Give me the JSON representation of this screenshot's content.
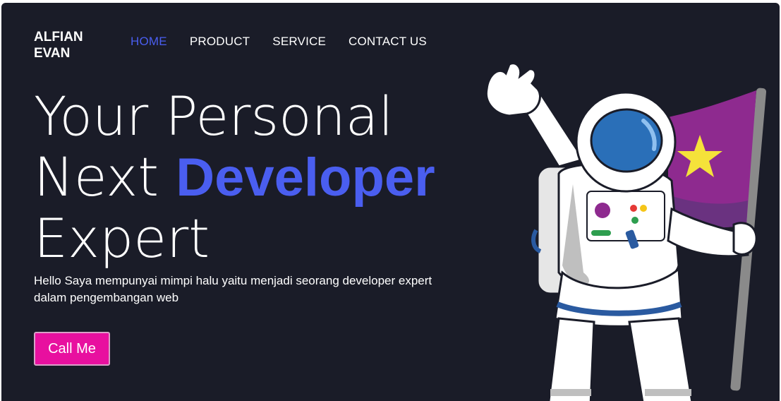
{
  "brand": {
    "line1": "ALFIAN",
    "line2": "EVAN"
  },
  "nav": {
    "items": [
      {
        "label": "HOME",
        "active": true
      },
      {
        "label": "PRODUCT",
        "active": false
      },
      {
        "label": "SERVICE",
        "active": false
      },
      {
        "label": "CONTACT US",
        "active": false
      }
    ]
  },
  "hero": {
    "line1": "Your Personal",
    "line2_prefix": "Next ",
    "line2_highlight": "Developer",
    "line3": "Expert",
    "description": "Hello Saya mempunyai mimpi halu yaitu menjadi seorang developer expert dalam pengembangan web",
    "cta_label": "Call Me"
  },
  "colors": {
    "background": "#1a1c28",
    "accent": "#4a5ef0",
    "cta": "#e8109f",
    "flag": "#8e2a8f",
    "star": "#f5e23a"
  },
  "illustration": {
    "icon": "astronaut-with-flag-illustration"
  }
}
